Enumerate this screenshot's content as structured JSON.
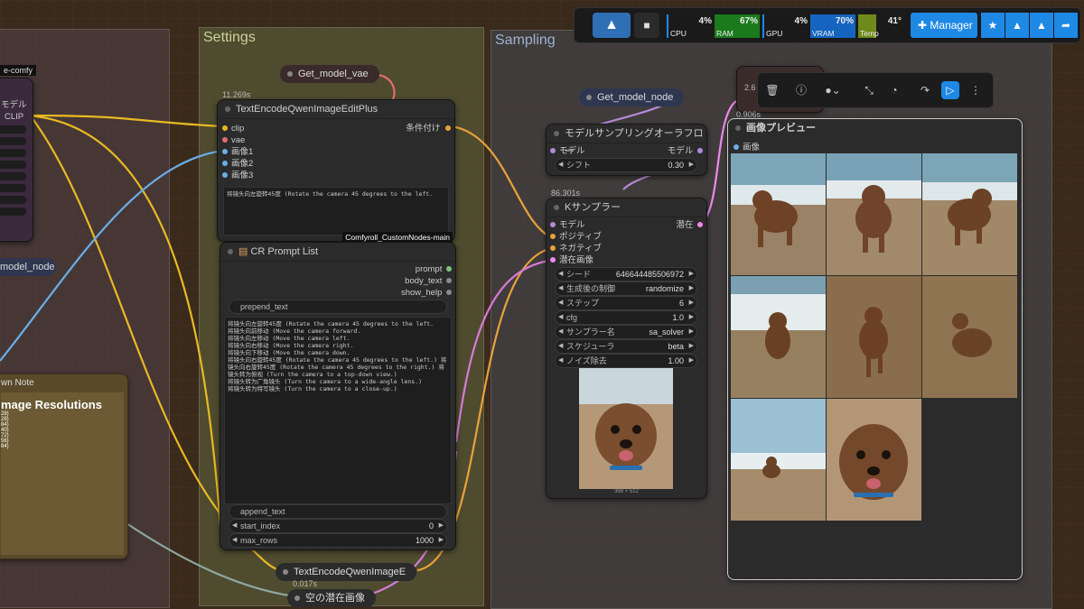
{
  "groups": {
    "settings": "Settings",
    "sampling": "Sampling"
  },
  "left_node": {
    "badge": "e-comfy",
    "model_label": "モデル",
    "clip_label": "CLIP",
    "model_node": "model_node",
    "note_title": "wn Note",
    "note_heading": "mage Resolutions",
    "note_lines": [
      "28)",
      "28)",
      "84)",
      "40)",
      "72)",
      "56)",
      "84)"
    ]
  },
  "get_model_vae": "Get_model_vae",
  "get_model_node": "Get_model_node",
  "text_encode": {
    "timing": "11.269s",
    "title": "TextEncodeQwenImageEditPlus",
    "inputs": [
      "clip",
      "vae",
      "画像1",
      "画像2",
      "画像3"
    ],
    "output": "条件付け",
    "prompt_text": "将镜头向左旋转45度 (Rotate the camera 45 degrees to the left.",
    "badge": "Comfyroll_CustomNodes-main"
  },
  "cr_prompt": {
    "title": "CR Prompt List",
    "outputs": [
      "prompt",
      "body_text",
      "show_help"
    ],
    "prepend_placeholder": "prepend_text",
    "text": "将镜头向左旋转45度 (Rotate the camera 45 degrees to the left.\n将镜头向前移动 (Move the camera forward.\n将镜头向左移动 (Move the camera left.\n将镜头向右移动 (Move the camera right.\n将镜头向下移动 (Move the camera down.\n将镜头向右旋转45度 (Rotate the camera 45 degrees to the left.) 将镜头向右旋转45度 (Rotate the camera 45 degrees to the right.) 将镜头转为俯视 (Turn the camera to a top-down view.)\n将镜头转为广角镜头 (Turn the camera to a wide-angle lens.)\n将镜头转为特写镜头 (Turn the camera to a close-up.)",
    "append_placeholder": "append_text",
    "start_index_label": "start_index",
    "start_index": "0",
    "max_rows_label": "max_rows",
    "max_rows": "1000"
  },
  "text_encode2": {
    "title": "TextEncodeQwenImageE",
    "timing": "0.017s"
  },
  "empty_latent": "空の潜在画像",
  "model_sampling": {
    "title": "モデルサンプリングオーラフロー",
    "in_label": "モデル",
    "out_label": "モデル",
    "shift_label": "シフト",
    "shift_value": "0.30"
  },
  "ksampler": {
    "timing": "86.301s",
    "title": "Kサンプラー",
    "inputs": [
      "モデル",
      "ポジティブ",
      "ネガティブ",
      "潜在画像"
    ],
    "output": "潜在",
    "widgets": [
      {
        "label": "シード",
        "value": "646644485506972"
      },
      {
        "label": "生成後の制御",
        "value": "randomize"
      },
      {
        "label": "ステップ",
        "value": "6"
      },
      {
        "label": "cfg",
        "value": "1.0"
      },
      {
        "label": "サンプラー名",
        "value": "sa_solver"
      },
      {
        "label": "スケジューラ",
        "value": "beta"
      },
      {
        "label": "ノイズ除去",
        "value": "1.00"
      }
    ],
    "preview_size": "398 × 512"
  },
  "preview": {
    "timing_top": "2.6",
    "timing": "0.906s",
    "title": "画像プレビュー",
    "input": "画像"
  },
  "topbar": {
    "cpu": {
      "name": "CPU",
      "pct": "4%"
    },
    "ram": {
      "name": "RAM",
      "pct": "67%"
    },
    "gpu": {
      "name": "GPU",
      "pct": "4%"
    },
    "vram": {
      "name": "VRAM",
      "pct": "70%"
    },
    "temp": {
      "name": "Temp",
      "pct": "41°"
    },
    "manager": "Manager"
  },
  "colors": {
    "accent": "#1e88e5",
    "ram": "#1b7a1b",
    "vram": "#1565c0",
    "temp": "#6d8a1a"
  }
}
